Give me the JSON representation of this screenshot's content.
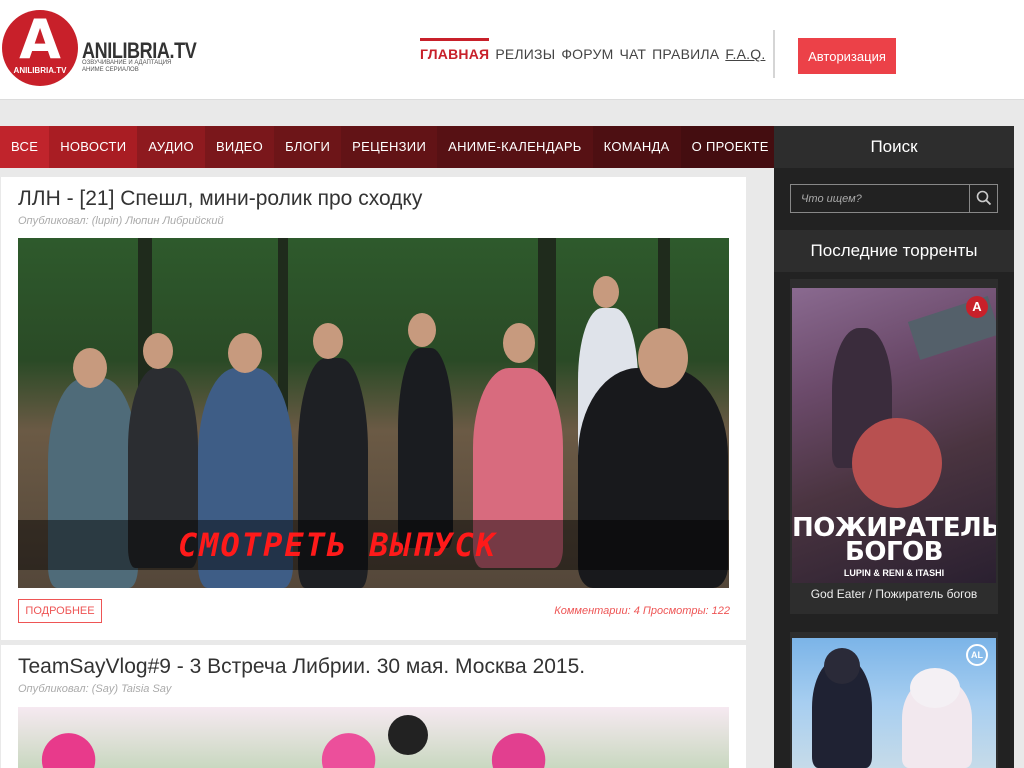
{
  "brand": {
    "logo_letter": "A",
    "logo_circle_text": "ANILIBRIA.TV",
    "name": "ANILIBRIA.TV",
    "tagline": "ОЗВУЧИВАНИЕ И АДАПТАЦИЯ АНИМЕ СЕРИАЛОВ",
    "primary_color": "#c8202a"
  },
  "top_nav": {
    "items": [
      "ГЛАВНАЯ",
      "РЕЛИЗЫ",
      "ФОРУМ",
      "ЧАТ",
      "ПРАВИЛА",
      "F.A.Q."
    ],
    "active_index": 0
  },
  "auth_button": "Авторизация",
  "category_nav": {
    "items": [
      {
        "label": "ВСЕ",
        "color": "#c0242c"
      },
      {
        "label": "НОВОСТИ",
        "color": "#a91d23"
      },
      {
        "label": "АУДИО",
        "color": "#8e1a1f"
      },
      {
        "label": "ВИДЕО",
        "color": "#7a171b"
      },
      {
        "label": "БЛОГИ",
        "color": "#6d1518"
      },
      {
        "label": "РЕЦЕНЗИИ",
        "color": "#621316"
      },
      {
        "label": "АНИМЕ-КАЛЕНДАРЬ",
        "color": "#571114"
      },
      {
        "label": "КОМАНДА",
        "color": "#4d0f12"
      },
      {
        "label": "О ПРОЕКТЕ",
        "color": "#440d10"
      }
    ]
  },
  "posts": [
    {
      "title": "ЛЛН - [21] Спешл, мини-ролик про сходку",
      "author": "Опубликовал: (lupin) Люпин Либрийский",
      "image_overlay_text": "СМОТРЕТЬ ВЫПУСК",
      "more_button": "ПОДРОБНЕЕ",
      "stats": "Комментарии: 4 Просмотры: 122"
    },
    {
      "title": "TeamSayVlog#9 - 3 Встреча Либрии. 30 мая. Москва 2015.",
      "author": "Опубликовал: (Say) Taisia Say"
    }
  ],
  "sidebar": {
    "search_heading": "Поиск",
    "search_placeholder": "Что ищем?",
    "torrents_heading": "Последние торренты",
    "torrents": [
      {
        "poster_logo": "A",
        "poster_title": "ПОЖИРАТЕЛЬ БОГОВ",
        "poster_credits": "LUPIN & RENI & ITASHI",
        "name": "God Eater / Пожиратель богов"
      },
      {
        "poster_logo": "AL"
      }
    ]
  }
}
